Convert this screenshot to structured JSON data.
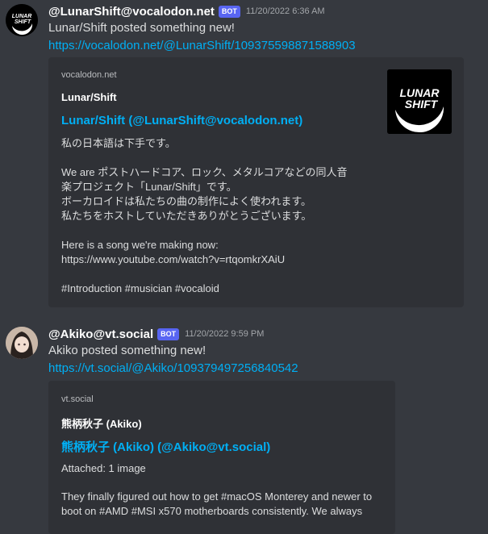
{
  "messages": [
    {
      "author": "@LunarShift@vocalodon.net",
      "badge": "BOT",
      "timestamp": "11/20/2022 6:36 AM",
      "text": "Lunar/Shift posted something new!",
      "link": "https://vocalodon.net/@LunarShift/109375598871588903",
      "avatar_text_1": "LUNAR",
      "avatar_text_2": "SHIFT",
      "embed": {
        "provider": "vocalodon.net",
        "author": "Lunar/Shift",
        "title": "Lunar/Shift (@LunarShift@vocalodon.net)",
        "description": "私の日本語は下手です。\n\nWe are ポストハードコア、ロック、メタルコアなどの同人音\n楽プロジェクト「Lunar/Shift」です。\nボーカロイドは私たちの曲の制作によく使われます。\n私たちをホストしていただきありがとうございます。\n\nHere is a song we're making now:\nhttps://www.youtube.com/watch?v=rtqomkrXAiU\n\n#Introduction #musician #vocaloid",
        "thumb_text_1": "LUNAR",
        "thumb_text_2": "SHIFT"
      }
    },
    {
      "author": "@Akiko@vt.social",
      "badge": "BOT",
      "timestamp": "11/20/2022 9:59 PM",
      "text": "Akiko posted something new!",
      "link": "https://vt.social/@Akiko/109379497256840542",
      "embed": {
        "provider": "vt.social",
        "author": "熊柄秋子 (Akiko)",
        "title": "熊柄秋子 (Akiko) (@Akiko@vt.social)",
        "attached": "Attached: 1 image",
        "description": "They finally figured out how to get #macOS Monterey and newer to\nboot on #AMD #MSI x570 motherboards consistently. We always"
      }
    }
  ],
  "colors": {
    "background": "#36393f",
    "embed_bg": "#2f3136",
    "link": "#00aff4",
    "bot_badge": "#5865f2"
  }
}
